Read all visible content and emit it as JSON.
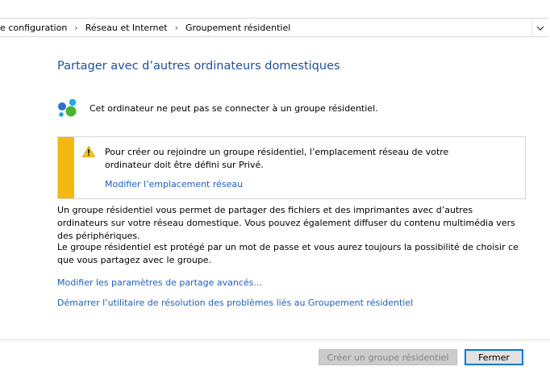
{
  "breadcrumb": {
    "items": [
      "le configuration",
      "Réseau et Internet",
      "Groupement résidentiel"
    ],
    "separator": "›",
    "dropdown_icon": "chevron-down-icon"
  },
  "page": {
    "title": "Partager avec d’autres ordinateurs domestiques",
    "status_icon": "homegroup-icon",
    "status_text": "Cet ordinateur ne peut pas se connecter à un groupe résidentiel."
  },
  "warning": {
    "icon": "warning-icon",
    "text": "Pour créer ou rejoindre un groupe résidentiel, l’emplacement réseau de votre ordinateur doit être défini sur Privé.",
    "link": "Modifier l’emplacement réseau",
    "stripe_color": "#f5b811"
  },
  "description": {
    "p1": "Un groupe résidentiel vous permet de partager des fichiers et des imprimantes avec d’autres ordinateurs sur votre réseau domestique. Vous pouvez également diffuser du contenu multimédia vers des périphériques.",
    "p2": "Le groupe résidentiel est protégé par un mot de passe et vous aurez toujours la possibilité de choisir ce que vous partagez avec le groupe."
  },
  "links": {
    "advanced_sharing": "Modifier les paramètres de partage avancés...",
    "troubleshooter": "Démarrer l’utilitaire de résolution des problèmes liés au Groupement résidentiel"
  },
  "buttons": {
    "create": "Créer un groupe résidentiel",
    "close": "Fermer"
  },
  "colors": {
    "title": "#1e4f9c",
    "link": "#1e5fb8",
    "focus_border": "#0078d7"
  }
}
